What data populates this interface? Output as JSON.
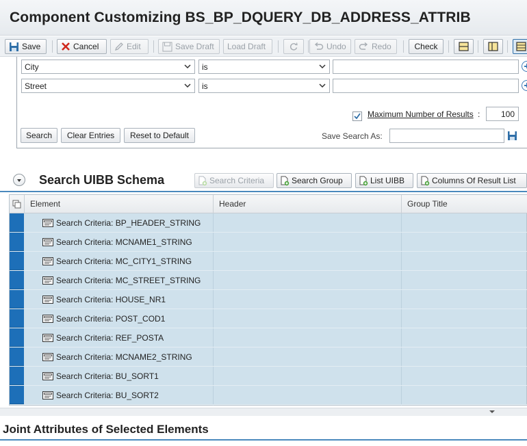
{
  "title": "Component Customizing BS_BP_DQUERY_DB_ADDRESS_ATTRIB",
  "toolbar": {
    "save": "Save",
    "cancel": "Cancel",
    "edit": "Edit",
    "save_draft": "Save Draft",
    "load_draft": "Load Draft",
    "undo": "Undo",
    "redo": "Redo",
    "check": "Check"
  },
  "search": {
    "rows": [
      {
        "attribute": "City",
        "operator": "is",
        "value": ""
      },
      {
        "attribute": "Street",
        "operator": "is",
        "value": ""
      }
    ],
    "max_results_label": "Maximum Number of Results",
    "max_results_colon": ":",
    "max_results_checked": true,
    "max_results_value": "100",
    "search_button": "Search",
    "clear_button": "Clear Entries",
    "reset_button": "Reset to Default",
    "save_search_label": "Save Search As:",
    "save_search_value": ""
  },
  "schema": {
    "title": "Search UIBB Schema",
    "buttons": {
      "search_criteria": "Search Criteria",
      "search_group": "Search Group",
      "list_uibb": "List UIBB",
      "columns": "Columns Of Result List"
    },
    "columns": [
      "Element",
      "Header",
      "Group Title"
    ],
    "rows": [
      "Search Criteria: BP_HEADER_STRING",
      "Search Criteria: MCNAME1_STRING",
      "Search Criteria: MC_CITY1_STRING",
      "Search Criteria: MC_STREET_STRING",
      "Search Criteria: HOUSE_NR1",
      "Search Criteria: POST_COD1",
      "Search Criteria: REF_POSTA",
      "Search Criteria: MCNAME2_STRING",
      "Search Criteria: BU_SORT1",
      "Search Criteria: BU_SORT2"
    ]
  },
  "joint": {
    "title": "Joint Attributes of Selected Elements"
  },
  "colors": {
    "accent": "#4a89bd",
    "row_bg": "#cfe1ec",
    "row_selector": "#1d6fb8"
  }
}
